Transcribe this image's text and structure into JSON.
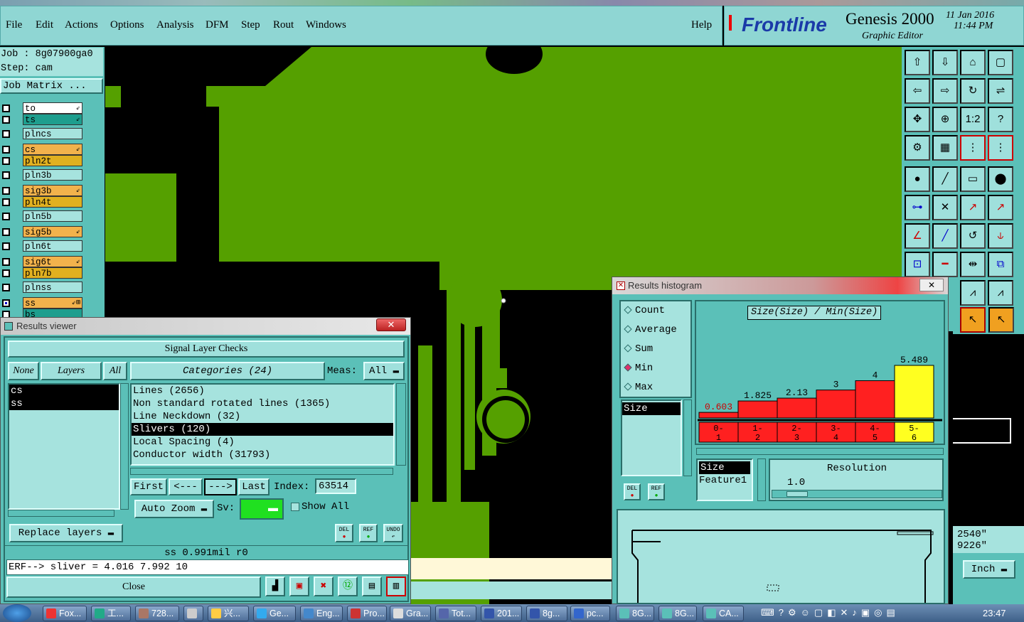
{
  "menu": {
    "items": [
      "File",
      "Edit",
      "Actions",
      "Options",
      "Analysis",
      "DFM",
      "Step",
      "Rout",
      "Windows"
    ],
    "help": "Help"
  },
  "brand": {
    "logo": "Frontline",
    "product": "Genesis 2000",
    "subtitle": "Graphic Editor",
    "date": "11 Jan 2016",
    "time": "11:44 PM"
  },
  "job": {
    "job_line": "Job : 8g07900ga0",
    "step_line": "Step: cam",
    "matrix_button": "Job Matrix ..."
  },
  "layers": [
    {
      "name": "to",
      "color": "#ffffff",
      "mark": "⇙"
    },
    {
      "name": "ts",
      "color": "#1e9e8e",
      "mark": "⇙"
    },
    {
      "name": "plncs",
      "color": "#a6e3de",
      "mark": ""
    },
    {
      "name": "cs",
      "color": "#f2b24c",
      "mark": "⇙"
    },
    {
      "name": "pln2t",
      "color": "#e0b020",
      "mark": ""
    },
    {
      "name": "pln3b",
      "color": "#a6e3de",
      "mark": ""
    },
    {
      "name": "sig3b",
      "color": "#f2b24c",
      "mark": "⇙"
    },
    {
      "name": "pln4t",
      "color": "#e0b020",
      "mark": ""
    },
    {
      "name": "pln5b",
      "color": "#a6e3de",
      "mark": ""
    },
    {
      "name": "sig5b",
      "color": "#f2b24c",
      "mark": "⇙"
    },
    {
      "name": "pln6t",
      "color": "#a6e3de",
      "mark": ""
    },
    {
      "name": "sig6t",
      "color": "#f2b24c",
      "mark": "⇙"
    },
    {
      "name": "pln7b",
      "color": "#e0b020",
      "mark": ""
    },
    {
      "name": "plnss",
      "color": "#a6e3de",
      "mark": ""
    },
    {
      "name": "ss",
      "color": "#f2b24c",
      "mark": "⇙⊞"
    },
    {
      "name": "bs",
      "color": "#1e9e8e",
      "mark": ""
    }
  ],
  "results_viewer": {
    "title": "Results viewer",
    "header": "Signal Layer Checks",
    "none_btn": "None",
    "layers_btn": "Layers",
    "all_btn": "All",
    "categories_btn": "Categories (24)",
    "meas_label": "Meas:",
    "meas_value": "All",
    "layers_list": [
      "cs",
      "ss"
    ],
    "categories": [
      "Lines (2656)",
      "Non standard rotated lines (1365)",
      "Line Neckdown (32)",
      "Slivers (120)",
      "Local Spacing (4)",
      "Conductor width (31793)"
    ],
    "selected_category_index": 3,
    "first_btn": "First",
    "prev_btn": "<---",
    "next_btn": "--->",
    "last_btn": "Last",
    "index_label": "Index:",
    "index_value": "63514",
    "auto_zoom": "Auto Zoom",
    "sv_label": "Sv:",
    "show_all": "Show All",
    "replace_layers": "Replace layers",
    "del": "DEL",
    "ref": "REF",
    "undo": "UNDO",
    "status": "ss 0.991mil  r0",
    "erf_line": "ERF--> sliver = 4.016 7.992 10",
    "close_btn": "Close"
  },
  "histogram": {
    "title": "Results histogram",
    "options": [
      "Count",
      "Average",
      "Sum",
      "Min",
      "Max"
    ],
    "selected_option": "Min",
    "chart_title": "Size(Size) / Min(Size)",
    "size_label": "Size",
    "feature_label": "Feature1",
    "resolution_label": "Resolution",
    "resolution_value": "1.0",
    "del": "DEL",
    "ref": "REF"
  },
  "chart_data": {
    "type": "bar",
    "title": "Size(Size) / Min(Size)",
    "categories": [
      "0-1",
      "1-2",
      "2-3",
      "3-4",
      "4-5",
      "5-6"
    ],
    "values": [
      0.603,
      1.825,
      2.13,
      3,
      4,
      5.489
    ],
    "value_labels": [
      "0.603",
      "1.825",
      "2.13",
      "3",
      "4",
      "5.489"
    ],
    "bar_colors": [
      "#ff2020",
      "#ff2020",
      "#ff2020",
      "#ff2020",
      "#ff2020",
      "#ffff20"
    ],
    "ylim": [
      0,
      5.489
    ]
  },
  "coords": {
    "x": "2540\"",
    "y": "9226\""
  },
  "units": "Inch",
  "taskbar": {
    "items": [
      "Fox...",
      "工...",
      "728...",
      "",
      "兴...",
      "Ge...",
      "Eng...",
      "Pro...",
      "Gra...",
      "Tot...",
      "201...",
      "8g...",
      "pc...",
      "8G...",
      "8G...",
      "CA..."
    ],
    "clock": "23:47"
  }
}
